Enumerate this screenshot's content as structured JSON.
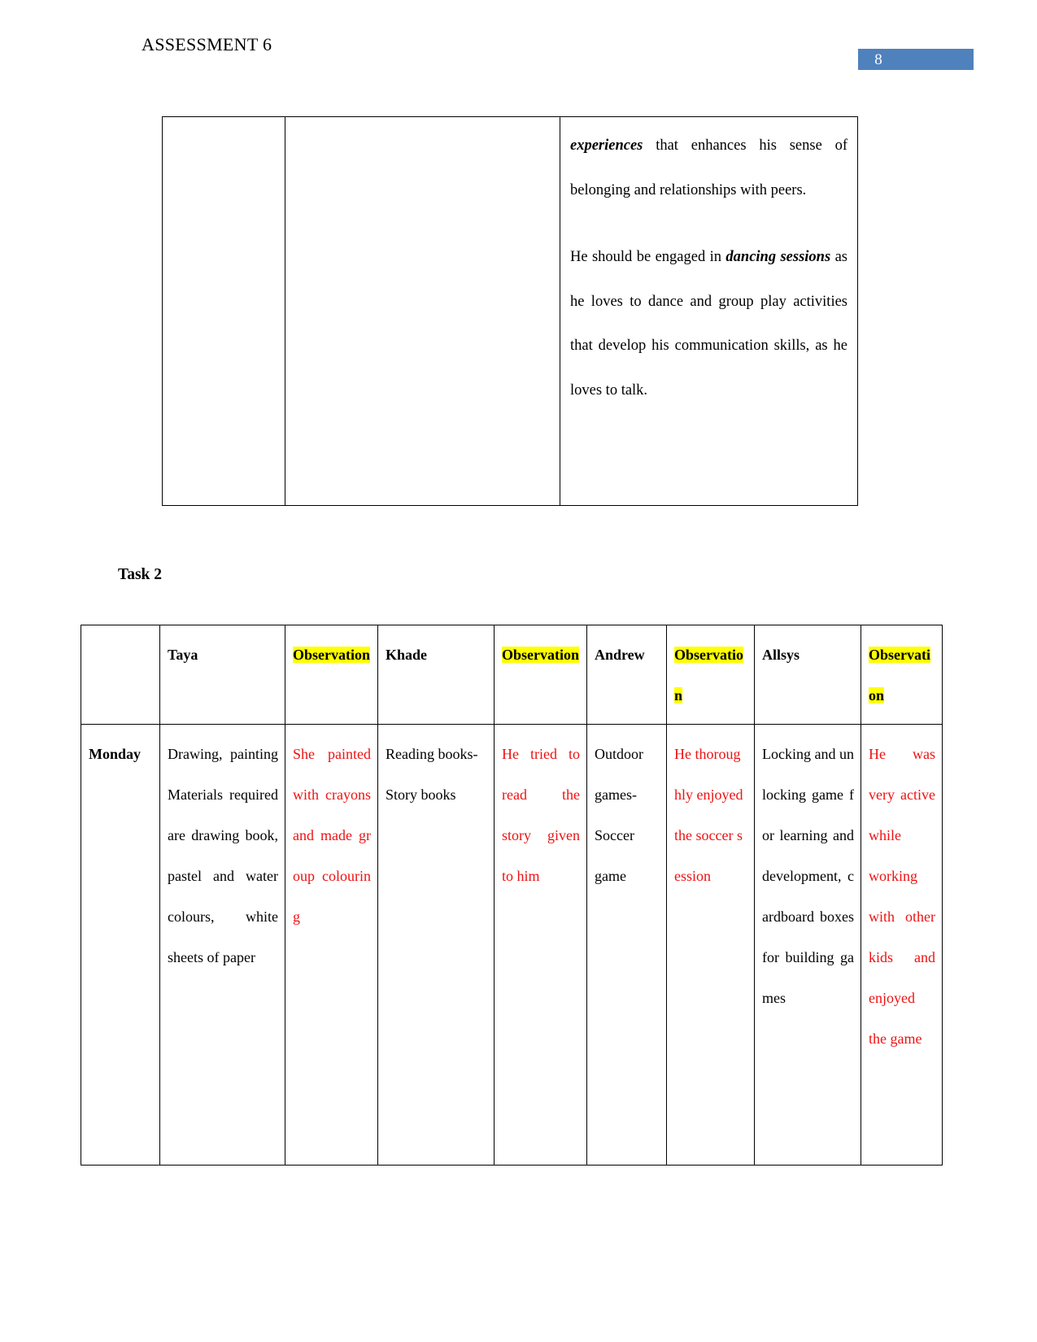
{
  "header": {
    "title": "ASSESSMENT 6",
    "page_number": "8",
    "page_number_bg": "#4f81bd"
  },
  "top_table": {
    "cells": [
      {
        "text": ""
      },
      {
        "text": ""
      }
    ],
    "content_paragraphs": {
      "p1_lead": "experiences",
      "p1_rest": " that enhances his sense of belonging and relationships with peers.",
      "p2_start": "He should be engaged in ",
      "p2_lead": "dancing sessions",
      "p2_rest": " as he loves to dance and group play activities that develop his communication skills, as he loves to talk."
    }
  },
  "task_heading": "Task 2",
  "main_table": {
    "headers": {
      "day_col": "",
      "name1": "Taya",
      "obs1": "Observation",
      "name2": "Khade",
      "obs2": "Observation",
      "name3": "Andrew",
      "obs3": "Observation",
      "name4": "Allsys",
      "obs4": "Observation"
    },
    "rows": [
      {
        "day": "Monday",
        "activity1": "Drawing, painting Materials required are drawing book, pastel and water colours, white sheets of paper",
        "observation1": "She painted with crayons and made group colouring",
        "activity2": "Reading books- Story books",
        "observation2": "He tried to read the story given to him",
        "activity3": "Outdoor games- Soccer game",
        "observation3": "He thoroughly enjoyed the soccer session",
        "activity4": "Locking and unlocking game for learning and development, cardboard boxes for building games",
        "observation4": "He was very active while working with other kids and enjoyed the game"
      }
    ]
  },
  "colors": {
    "observation_text": "#ee1111",
    "highlight": "#ffff00",
    "page_number_bg": "#4f81bd"
  }
}
